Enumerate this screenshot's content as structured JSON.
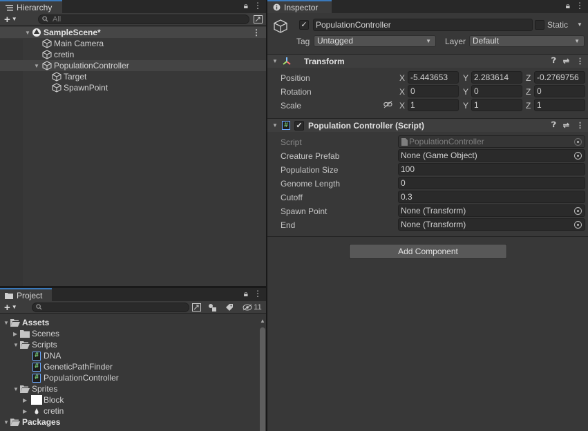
{
  "hierarchy": {
    "tab_label": "Hierarchy",
    "search_placeholder": "All",
    "scene_name": "SampleScene*",
    "items": [
      {
        "label": "Main Camera"
      },
      {
        "label": "cretin"
      },
      {
        "label": "PopulationController"
      },
      {
        "label": "Target"
      },
      {
        "label": "SpawnPoint"
      }
    ]
  },
  "project": {
    "tab_label": "Project",
    "search_value": "",
    "hidden_count": "11",
    "tree": {
      "assets": "Assets",
      "scenes": "Scenes",
      "scripts": "Scripts",
      "script_items": [
        "DNA",
        "GeneticPathFinder",
        "PopulationController"
      ],
      "sprites": "Sprites",
      "sprite_items": [
        "Block",
        "cretin"
      ],
      "packages": "Packages"
    }
  },
  "inspector": {
    "tab_label": "Inspector",
    "object_name": "PopulationController",
    "static_label": "Static",
    "tag_label": "Tag",
    "tag_value": "Untagged",
    "layer_label": "Layer",
    "layer_value": "Default",
    "transform": {
      "title": "Transform",
      "position_label": "Position",
      "rotation_label": "Rotation",
      "scale_label": "Scale",
      "axis_x": "X",
      "axis_y": "Y",
      "axis_z": "Z",
      "position": {
        "x": "-5.443653",
        "y": "2.283614",
        "z": "-0.2769756"
      },
      "rotation": {
        "x": "0",
        "y": "0",
        "z": "0"
      },
      "scale": {
        "x": "1",
        "y": "1",
        "z": "1"
      }
    },
    "script_component": {
      "title": "Population Controller (Script)",
      "fields": [
        {
          "label": "Script",
          "value": "PopulationController"
        },
        {
          "label": "Creature Prefab",
          "value": "None (Game Object)"
        },
        {
          "label": "Population Size",
          "value": "100"
        },
        {
          "label": "Genome Length",
          "value": "0"
        },
        {
          "label": "Cutoff",
          "value": "0.3"
        },
        {
          "label": "Spawn Point",
          "value": "None (Transform)"
        },
        {
          "label": "End",
          "value": "None (Transform)"
        }
      ]
    },
    "add_component_label": "Add Component"
  },
  "colors": {
    "selection_tab_accent": "#3a79bb",
    "script_icon_green": "#7ed67e",
    "panel_bg": "#383838"
  }
}
